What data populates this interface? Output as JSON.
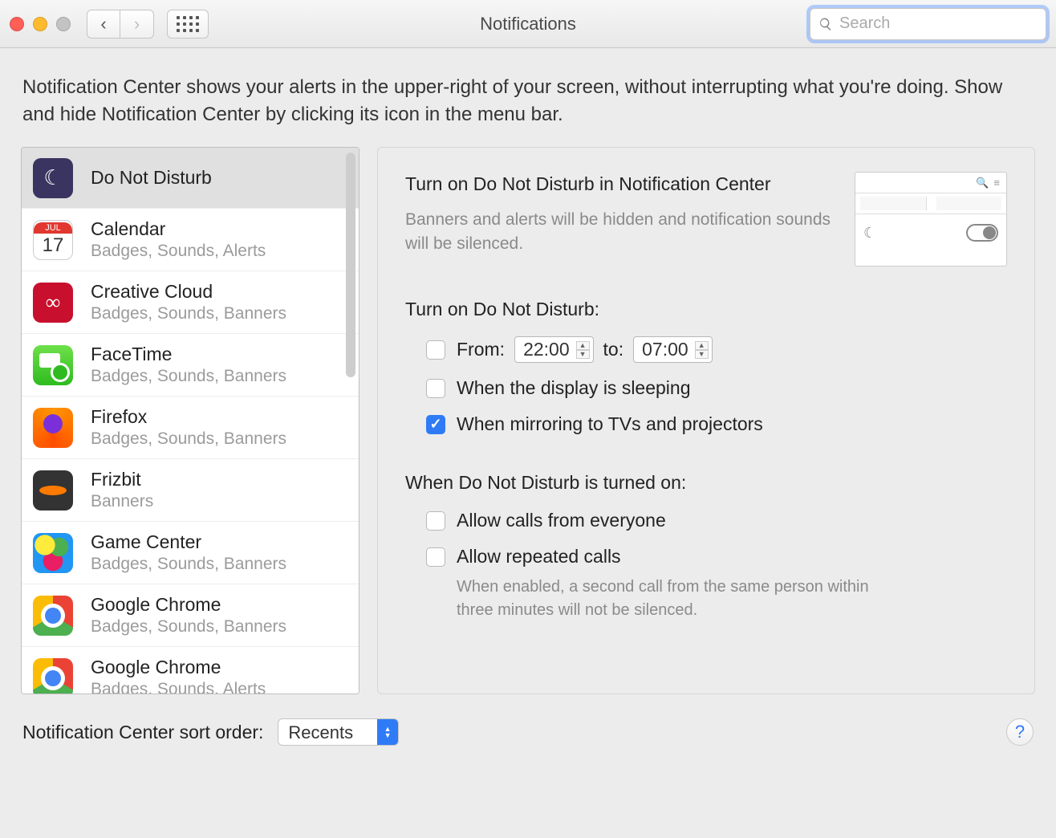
{
  "window": {
    "title": "Notifications",
    "search_placeholder": "Search"
  },
  "description": "Notification Center shows your alerts in the upper-right of your screen, without interrupting what you're doing. Show and hide Notification Center by clicking its icon in the menu bar.",
  "sidebar": {
    "items": [
      {
        "name": "Do Not Disturb",
        "detail": "",
        "icon": "dnd",
        "selected": true
      },
      {
        "name": "Calendar",
        "detail": "Badges, Sounds, Alerts",
        "icon": "cal",
        "selected": false,
        "cal_month": "JUL",
        "cal_day": "17"
      },
      {
        "name": "Creative Cloud",
        "detail": "Badges, Sounds, Banners",
        "icon": "cc",
        "selected": false
      },
      {
        "name": "FaceTime",
        "detail": "Badges, Sounds, Banners",
        "icon": "ft",
        "selected": false
      },
      {
        "name": "Firefox",
        "detail": "Badges, Sounds, Banners",
        "icon": "ff",
        "selected": false
      },
      {
        "name": "Frizbit",
        "detail": "Banners",
        "icon": "fz",
        "selected": false
      },
      {
        "name": "Game Center",
        "detail": "Badges, Sounds, Banners",
        "icon": "gc",
        "selected": false
      },
      {
        "name": "Google Chrome",
        "detail": "Badges, Sounds, Banners",
        "icon": "ch",
        "selected": false
      },
      {
        "name": "Google Chrome",
        "detail": "Badges, Sounds, Alerts",
        "icon": "ch",
        "selected": false
      }
    ]
  },
  "panel": {
    "title": "Turn on Do Not Disturb in Notification Center",
    "subtitle": "Banners and alerts will be hidden and notification sounds will be silenced.",
    "section1_label": "Turn on Do Not Disturb:",
    "from_label": "From:",
    "from_time": "22:00",
    "to_label": "to:",
    "to_time": "07:00",
    "opt_sleeping": "When the display is sleeping",
    "opt_mirroring": "When mirroring to TVs and projectors",
    "section2_label": "When Do Not Disturb is turned on:",
    "opt_everyone": "Allow calls from everyone",
    "opt_repeated": "Allow repeated calls",
    "repeated_note": "When enabled, a second call from the same person within three minutes will not be silenced.",
    "checks": {
      "from": false,
      "sleeping": false,
      "mirroring": true,
      "everyone": false,
      "repeated": false
    }
  },
  "footer": {
    "label": "Notification Center sort order:",
    "value": "Recents",
    "help": "?"
  }
}
